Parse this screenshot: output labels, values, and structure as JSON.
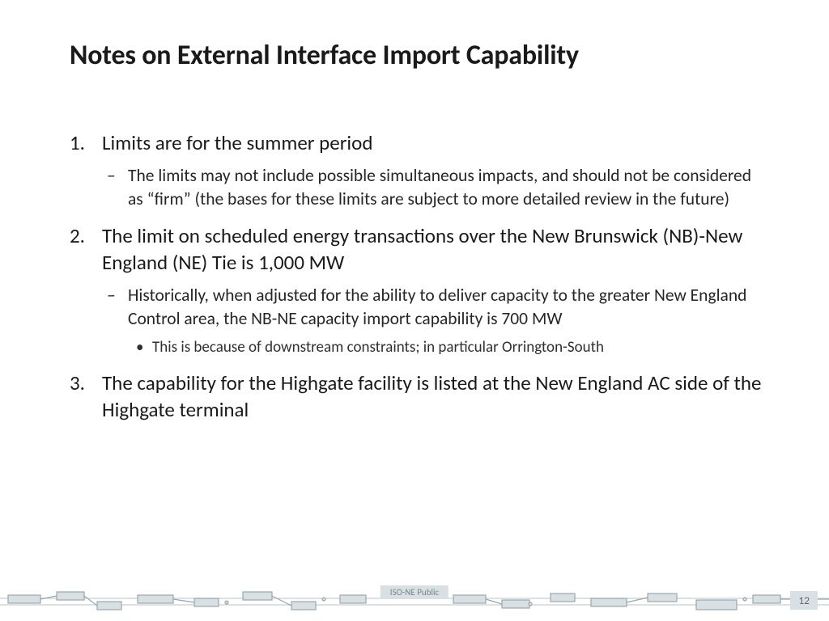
{
  "title": "Notes on External Interface Import Capability",
  "items": [
    {
      "text": "Limits are for the summer period",
      "sub": [
        {
          "text": "The limits may not include possible simultaneous impacts, and should not be considered as “firm” (the bases for these limits are subject to more detailed review in the future)"
        }
      ]
    },
    {
      "text": "The limit on scheduled energy transactions over the New Brunswick (NB)-New England (NE) Tie is 1,000 MW",
      "sub": [
        {
          "text": "Historically, when adjusted for the ability to deliver capacity to the greater New England Control area, the NB-NE capacity import capability is 700 MW",
          "subsub": [
            {
              "text": "This is because of downstream constraints; in particular Orrington-South"
            }
          ]
        }
      ]
    },
    {
      "text": "The capability for the Highgate facility is listed at the New England AC side of the Highgate terminal"
    }
  ],
  "footer": {
    "label": "ISO-NE Public",
    "page": "12"
  }
}
